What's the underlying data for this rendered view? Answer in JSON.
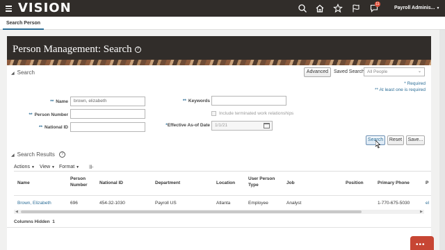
{
  "header": {
    "logo": "VISION",
    "notification_count": "11",
    "user_menu": "Payroll Adminis..."
  },
  "tabs": {
    "active": "Search Person"
  },
  "page": {
    "title": "Person Management: Search"
  },
  "search": {
    "section_label": "Search",
    "advanced_label": "Advanced",
    "saved_search_label": "Saved Search",
    "saved_search_value": "All People",
    "required_note": "* Required",
    "at_least_one_note": "** At least one is required",
    "fields": {
      "name": {
        "marker": "**",
        "label": "Name",
        "value": "brown, elizabeth"
      },
      "person_number": {
        "marker": "**",
        "label": "Person Number",
        "value": ""
      },
      "national_id": {
        "marker": "**",
        "label": "National ID",
        "value": ""
      },
      "keywords": {
        "marker": "**",
        "label": "Keywords",
        "value": ""
      },
      "include_terminated": {
        "label": "Include terminated work relationships",
        "checked": false
      },
      "effective_date": {
        "marker": "*",
        "label": "Effective As-of Date",
        "value": "1/1/21"
      }
    },
    "buttons": {
      "search": "Search",
      "reset": "Reset",
      "save": "Save..."
    }
  },
  "results": {
    "section_label": "Search Results",
    "toolbar": {
      "actions": "Actions",
      "view": "View",
      "format": "Format"
    },
    "columns": [
      "Name",
      "Person Number",
      "National ID",
      "Department",
      "Location",
      "User Person Type",
      "Job",
      "Position",
      "Primary Phone",
      "P"
    ],
    "rows": [
      {
        "name": "Brown, Elizabeth",
        "person_number": "696",
        "national_id": "454-32-1030",
        "department": "Payroll US",
        "location": "Atlanta",
        "user_person_type": "Employee",
        "job": "Analyst",
        "position": "",
        "primary_phone": "1-770-675-5030",
        "p": "el"
      }
    ],
    "columns_hidden_label": "Columns Hidden",
    "columns_hidden_count": "1"
  }
}
